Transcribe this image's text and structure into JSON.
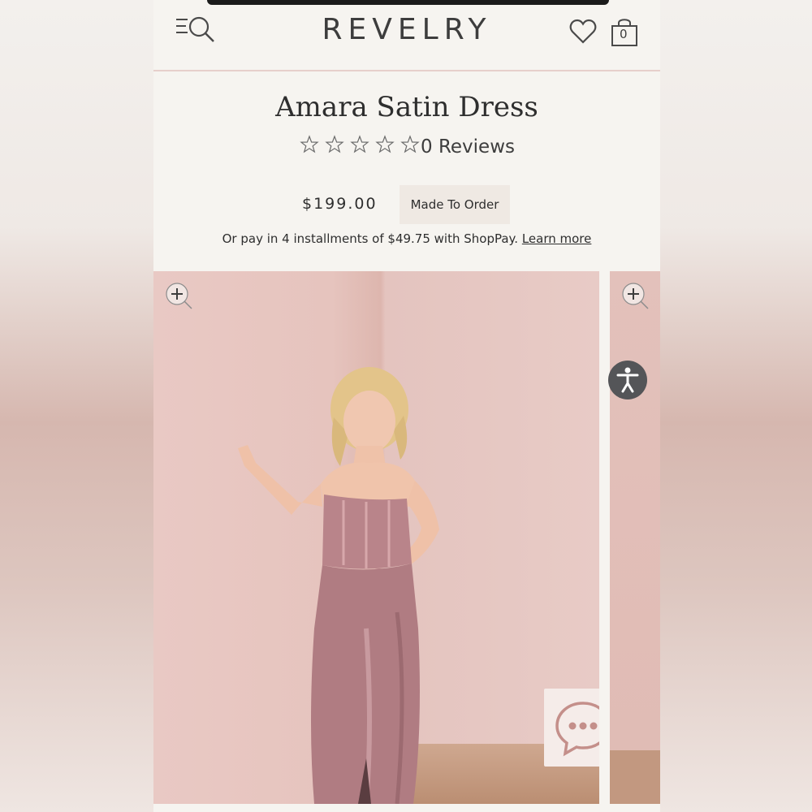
{
  "header": {
    "brand": "REVELRY",
    "menu_icon": "menu-search-icon",
    "wishlist_icon": "heart-icon",
    "bag_icon": "shopping-bag-icon",
    "bag_count": "0"
  },
  "product": {
    "title": "Amara Satin Dress",
    "rating": 0,
    "rating_max": 5,
    "reviews_label": "0 Reviews",
    "price": "$199.00",
    "badge": "Made To Order",
    "installments_text": "Or pay in 4 installments of $49.75 with ShopPay.",
    "learn_more": "Learn more"
  },
  "gallery": {
    "zoom_icon": "zoom-in-icon",
    "accessibility_icon": "accessibility-icon",
    "chat_icon": "chat-bubble-icon"
  },
  "colors": {
    "background": "#f6f4f0",
    "text": "#2e2e2e",
    "divider": "#e6cfcb",
    "dress": "#b9848a",
    "badge_bg": "#efe9e3"
  }
}
